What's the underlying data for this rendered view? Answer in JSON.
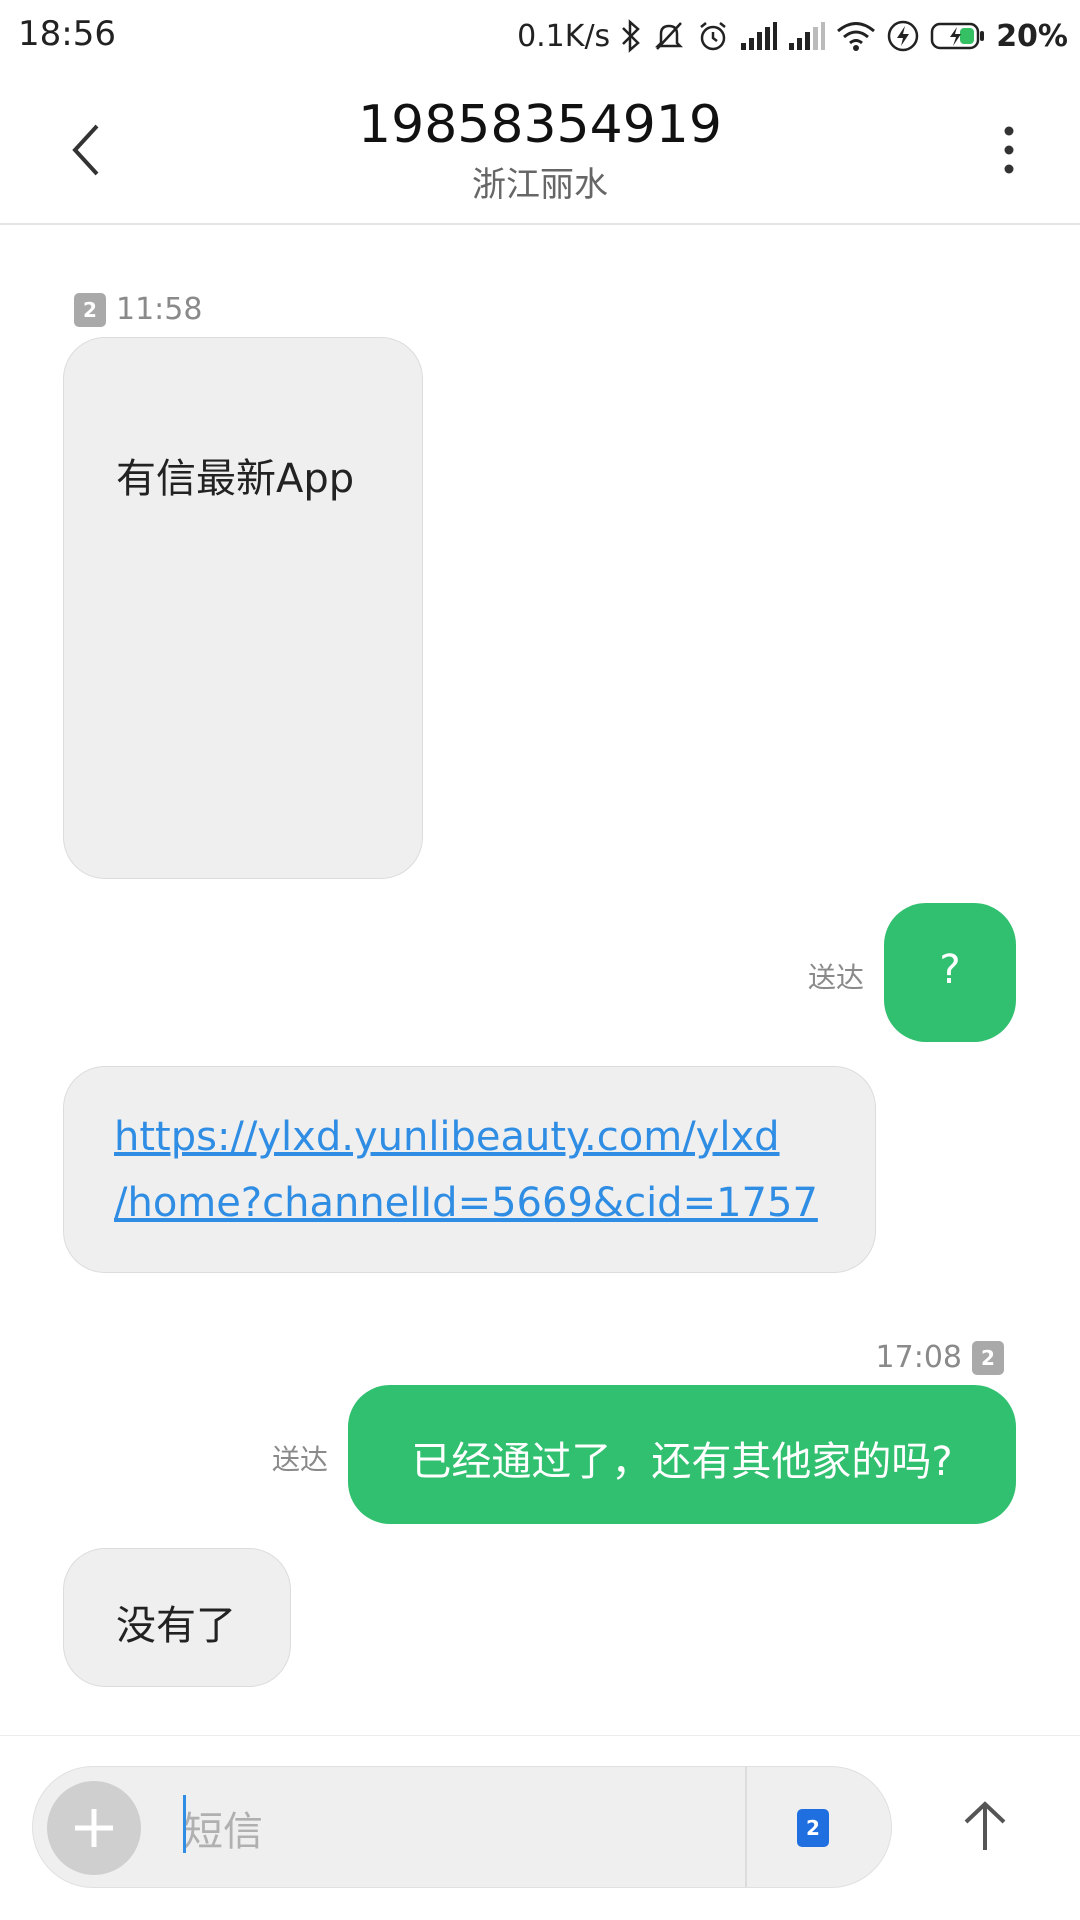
{
  "status_bar": {
    "time": "18:56",
    "network_speed": "0.1K/s",
    "battery_percent": "20%",
    "icons": [
      "bluetooth-icon",
      "mute-icon",
      "alarm-icon",
      "signal-icon",
      "signal-icon",
      "wifi-icon",
      "charging-icon",
      "battery-icon"
    ]
  },
  "header": {
    "contact_number": "19858354919",
    "contact_location": "浙江丽水"
  },
  "messages": [
    {
      "direction": "incoming",
      "sim": "2",
      "time": "11:58",
      "text": "有信最新App"
    },
    {
      "direction": "outgoing",
      "status": "送达",
      "text": "?"
    },
    {
      "direction": "incoming",
      "link_line1": "https://ylxd.yunlibeauty.com/ylxd",
      "link_line2": "/home?channelId=5669&cid=1757"
    },
    {
      "direction": "outgoing",
      "time": "17:08",
      "sim": "2",
      "status": "送达",
      "text": "已经通过了，还有其他家的吗?"
    },
    {
      "direction": "incoming",
      "text": "没有了"
    }
  ],
  "composer": {
    "placeholder": "短信",
    "sim": "2"
  },
  "colors": {
    "outgoing_bubble": "#31c06f",
    "incoming_bubble": "#efefef",
    "link": "#2f8de4",
    "sim_active": "#1f6fe0"
  }
}
